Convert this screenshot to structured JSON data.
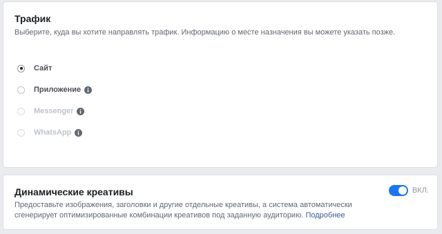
{
  "traffic": {
    "title": "Трафик",
    "description": "Выберите, куда вы хотите направлять трафик. Информацию о месте назначения вы можете указать позже.",
    "options": [
      {
        "label": "Сайт",
        "selected": true,
        "disabled": false,
        "info": false
      },
      {
        "label": "Приложение",
        "selected": false,
        "disabled": false,
        "info": true
      },
      {
        "label": "Messenger",
        "selected": false,
        "disabled": true,
        "info": true
      },
      {
        "label": "WhatsApp",
        "selected": false,
        "disabled": true,
        "info": true
      }
    ]
  },
  "dynamic_creatives": {
    "title": "Динамические креативы",
    "description": "Предоставьте изображения, заголовки и другие отдельные креативы, а система автоматически сгенерирует оптимизированные комбинации креативов под заданную аудиторию.",
    "link_label": "Подробнее",
    "toggle_on": true,
    "toggle_label": "ВКЛ."
  },
  "colors": {
    "accent": "#1877f2",
    "link": "#385898",
    "background": "#e9ebee"
  },
  "icons": {
    "info": "info-icon"
  }
}
